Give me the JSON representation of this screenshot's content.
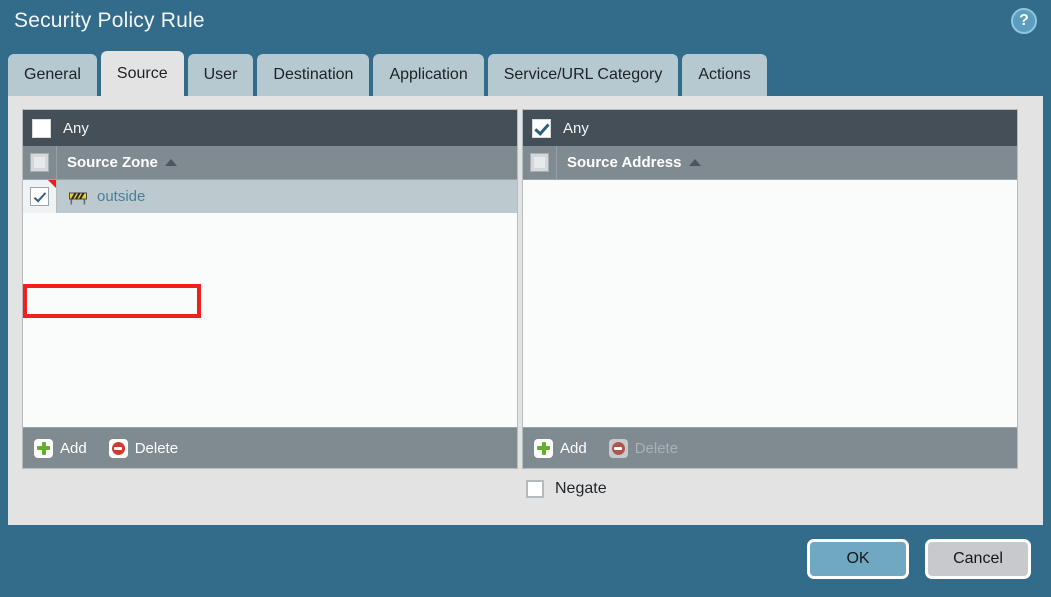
{
  "dialog": {
    "title": "Security Policy Rule",
    "help_icon": "help-circle-icon",
    "help_glyph": "?"
  },
  "tabs": [
    {
      "label": "General",
      "active": false
    },
    {
      "label": "Source",
      "active": true
    },
    {
      "label": "User",
      "active": false
    },
    {
      "label": "Destination",
      "active": false
    },
    {
      "label": "Application",
      "active": false
    },
    {
      "label": "Service/URL Category",
      "active": false
    },
    {
      "label": "Actions",
      "active": false
    }
  ],
  "panels": {
    "source_zone": {
      "any_label": "Any",
      "any_checked": false,
      "column_header": "Source Zone",
      "header_checkbox_state": "disabled",
      "sort_direction": "ascending",
      "rows": [
        {
          "label": "outside",
          "checked": true,
          "selected": true,
          "icon": "zone-barrier-icon",
          "flagged": true
        }
      ],
      "add_label": "Add",
      "delete_label": "Delete",
      "add_enabled": true,
      "delete_enabled": true
    },
    "source_address": {
      "any_label": "Any",
      "any_checked": true,
      "column_header": "Source Address",
      "header_checkbox_state": "disabled",
      "sort_direction": "ascending",
      "rows": [],
      "add_label": "Add",
      "delete_label": "Delete",
      "add_enabled": true,
      "delete_enabled": false
    }
  },
  "negate": {
    "label": "Negate",
    "checked": false
  },
  "footer": {
    "ok_label": "OK",
    "cancel_label": "Cancel"
  },
  "annotation": {
    "type": "highlight-rectangle",
    "color": "#ef2020",
    "target": "source-zone-row-outside"
  },
  "colors": {
    "window_chrome": "#336b8b",
    "content_bg": "#e3e3e3",
    "tab_inactive": "#b6c9d0",
    "tab_active": "#e3e3e3",
    "any_bar": "#454f57",
    "column_header": "#808a91",
    "row_selected": "#bcc9ce",
    "list_bg": "#fafcfc",
    "link_text": "#4a7f9c",
    "ok_button": "#6fa8c0",
    "cancel_button": "#c8c9cd",
    "annotation_red": "#ef2020"
  }
}
